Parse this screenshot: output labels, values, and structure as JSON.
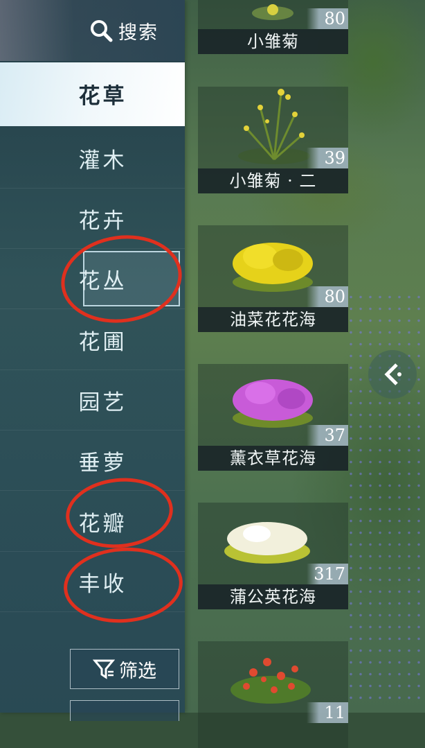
{
  "search": {
    "label": "搜索",
    "icon": "search-icon"
  },
  "categories": [
    {
      "label": "花草",
      "active": true
    },
    {
      "label": "灌木"
    },
    {
      "label": "花卉"
    },
    {
      "label": "花丛",
      "framed": true
    },
    {
      "label": "花圃"
    },
    {
      "label": "园艺"
    },
    {
      "label": "垂萝"
    },
    {
      "label": "花瓣"
    },
    {
      "label": "丰收"
    }
  ],
  "filter": {
    "label": "筛选",
    "icon": "filter-icon"
  },
  "items": [
    {
      "name": "小雏菊",
      "count": "80",
      "color": "#d8d040"
    },
    {
      "name": "小雏菊 · 二",
      "count": "39",
      "color": "#e3d23a"
    },
    {
      "name": "油菜花花海",
      "count": "80",
      "color": "#e6d21a"
    },
    {
      "name": "薰衣草花海",
      "count": "37",
      "color": "#c85bd8"
    },
    {
      "name": "蒲公英花海",
      "count": "317",
      "color": "#f2f0dc"
    },
    {
      "name": "",
      "count": "11",
      "color": "#e04a30"
    }
  ],
  "collapse_icon": "chevron-left-icon",
  "annotation_color": "#e0301e"
}
